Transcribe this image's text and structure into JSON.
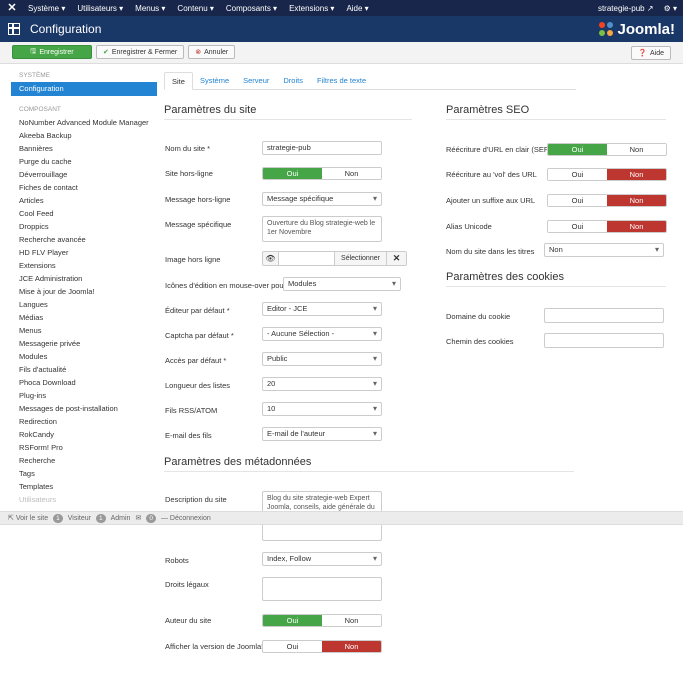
{
  "navbar": {
    "menu": [
      "Système ▾",
      "Utilisateurs ▾",
      "Menus ▾",
      "Contenu ▾",
      "Composants ▾",
      "Extensions ▾",
      "Aide ▾"
    ],
    "site_name": "strategie-pub",
    "settings": "⚙ ▾"
  },
  "header": {
    "title": "Configuration",
    "brand": "Joomla!"
  },
  "toolbar": {
    "save": "Enregistrer",
    "save_close": "Enregistrer & Fermer",
    "cancel": "Annuler",
    "help": "Aide"
  },
  "sidebar": {
    "system_head": "Système",
    "system_active": "Configuration",
    "components_head": "Composant",
    "items": [
      "NoNumber Advanced Module Manager",
      "Akeeba Backup",
      "Bannières",
      "Purge du cache",
      "Déverrouillage",
      "Fiches de contact",
      "Articles",
      "Cool Feed",
      "Droppics",
      "Recherche avancée",
      "HD FLV Player",
      "Extensions",
      "JCE Administration",
      "Mise à jour de Joomla!",
      "Langues",
      "Médias",
      "Menus",
      "Messagerie privée",
      "Modules",
      "Fils d'actualité",
      "Phoca Download",
      "Plug-ins",
      "Messages de post-installation",
      "Redirection",
      "RokCandy",
      "RSForm! Pro",
      "Recherche",
      "Tags",
      "Templates"
    ],
    "faded_item": "Utilisateurs"
  },
  "tabs": [
    "Site",
    "Système",
    "Serveur",
    "Droits",
    "Filtres de texte"
  ],
  "site": {
    "heading": "Paramètres du site",
    "rows": {
      "sitename": {
        "label": "Nom du site *",
        "value": "strategie-pub"
      },
      "offline": {
        "label": "Site hors-ligne",
        "on": "Oui",
        "off": "Non"
      },
      "offline_msg": {
        "label": "Message hors-ligne",
        "value": "Message spécifique"
      },
      "custom_msg": {
        "label": "Message spécifique",
        "value": "Ouverture du Blog strategie-web le 1er Novembre"
      },
      "offline_img": {
        "label": "Image hors ligne",
        "select": "Sélectionner"
      },
      "edit_icons": {
        "label": "Icônes d'édition en mouse-over pour",
        "value": "Modules"
      },
      "editor": {
        "label": "Éditeur par défaut *",
        "value": "Editor - JCE"
      },
      "captcha": {
        "label": "Captcha par défaut *",
        "value": "- Aucune Sélection -"
      },
      "access": {
        "label": "Accès par défaut *",
        "value": "Public"
      },
      "list_limit": {
        "label": "Longueur des listes",
        "value": "20"
      },
      "feed_limit": {
        "label": "Fils RSS/ATOM",
        "value": "10"
      },
      "feed_email": {
        "label": "E-mail des fils",
        "value": "E-mail de l'auteur"
      }
    }
  },
  "meta": {
    "heading": "Paramètres des métadonnées",
    "desc": {
      "label": "Description du site",
      "value": "Blog du site strategie-web Expert Joomla, conseils, aide générale du"
    },
    "robots": {
      "label": "Robots",
      "value": "Index, Follow"
    },
    "rights": {
      "label": "Droits légaux",
      "value": ""
    },
    "author": {
      "label": "Auteur du site",
      "on": "Oui",
      "off": "Non"
    },
    "version": {
      "label": "Afficher la version de Joomla!",
      "on": "Oui",
      "off": "Non"
    }
  },
  "seo": {
    "heading": "Paramètres SEO",
    "sef": {
      "label": "Réécriture d'URL en clair (SEF)",
      "on": "Oui",
      "off": "Non"
    },
    "rewrite": {
      "label": "Réécriture au 'vol' des URL",
      "on": "Oui",
      "off": "Non"
    },
    "suffix": {
      "label": "Ajouter un suffixe aux URL",
      "on": "Oui",
      "off": "Non"
    },
    "unicode": {
      "label": "Alias Unicode",
      "on": "Oui",
      "off": "Non"
    },
    "sitename_titles": {
      "label": "Nom du site dans les titres",
      "value": "Non"
    }
  },
  "cookies": {
    "heading": "Paramètres des cookies",
    "domain": {
      "label": "Domaine du cookie",
      "value": ""
    },
    "path": {
      "label": "Chemin des cookies",
      "value": ""
    }
  },
  "statusbar": {
    "view_site": "Voir le site",
    "visitors_count": "1",
    "visitors": "Visiteur",
    "admins_count": "1",
    "admins": "Admin",
    "messages_count": "0",
    "logout": "Déconnexion"
  }
}
